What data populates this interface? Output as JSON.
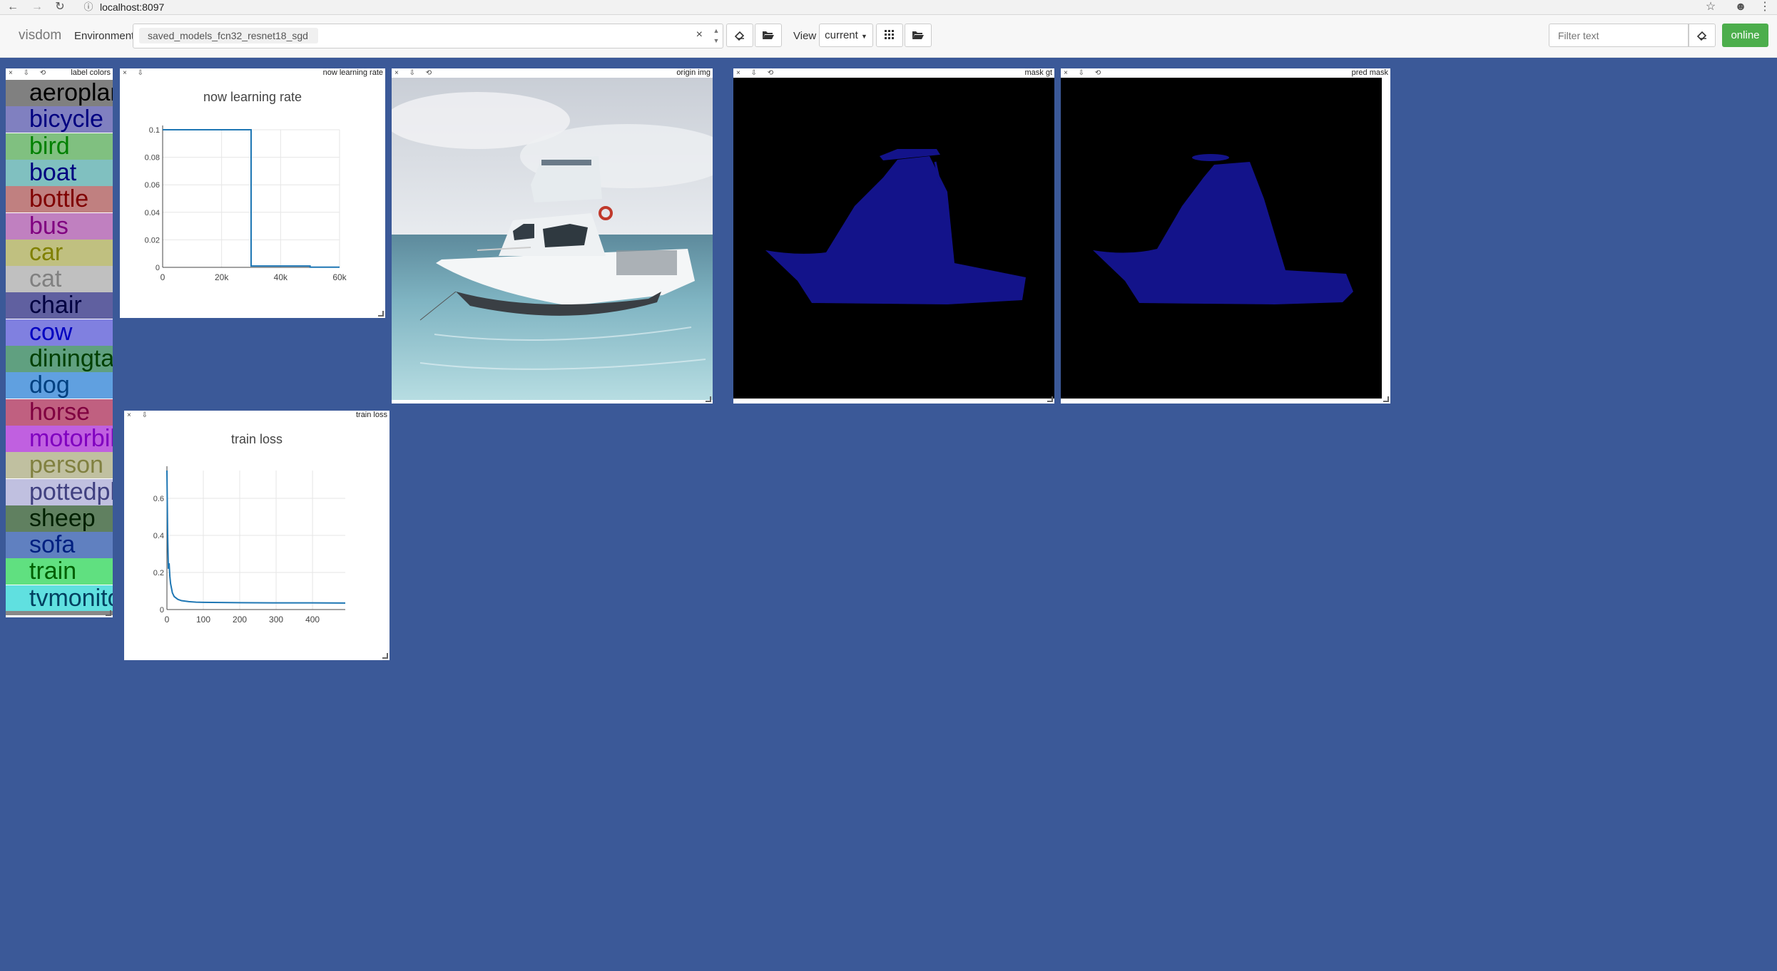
{
  "browser": {
    "url": "localhost:8097",
    "icons": [
      "back-arrow-icon",
      "forward-arrow-icon",
      "reload-icon",
      "info-icon",
      "star-icon",
      "account-icon",
      "menu-icon"
    ]
  },
  "toolbar": {
    "brand": "visdom",
    "environment_label": "Environment",
    "environment_value": "saved_models_fcn32_resnet18_sgd",
    "clear_symbol": "×",
    "view_label": "View",
    "view_value": "current",
    "filter_placeholder": "Filter text",
    "status": "online",
    "status_color": "#4cae4c"
  },
  "panes": {
    "labels": {
      "title": "label colors",
      "items": [
        {
          "label": "aeroplane",
          "color": "#808080",
          "text_color": "#000000"
        },
        {
          "label": "bicycle",
          "color": "#8080c0",
          "text_color": "#000080"
        },
        {
          "label": "bird",
          "color": "#80c080",
          "text_color": "#008000"
        },
        {
          "label": "boat",
          "color": "#80c0c0",
          "text_color": "#000080"
        },
        {
          "label": "bottle",
          "color": "#c08080",
          "text_color": "#800000"
        },
        {
          "label": "bus",
          "color": "#c080c0",
          "text_color": "#800080"
        },
        {
          "label": "car",
          "color": "#c0c080",
          "text_color": "#808000"
        },
        {
          "label": "cat",
          "color": "#c0c0c0",
          "text_color": "#808080"
        },
        {
          "label": "chair",
          "color": "#6060a0",
          "text_color": "#000040"
        },
        {
          "label": "cow",
          "color": "#8080e0",
          "text_color": "#0000c0"
        },
        {
          "label": "diningtable",
          "color": "#60a080",
          "text_color": "#004000"
        },
        {
          "label": "dog",
          "color": "#60a0e0",
          "text_color": "#004080"
        },
        {
          "label": "horse",
          "color": "#c06080",
          "text_color": "#800040"
        },
        {
          "label": "motorbike",
          "color": "#c060e0",
          "text_color": "#8000c0"
        },
        {
          "label": "person",
          "color": "#c0c0a0",
          "text_color": "#808040"
        },
        {
          "label": "pottedplant",
          "color": "#c0c0e0",
          "text_color": "#404080"
        },
        {
          "label": "sheep",
          "color": "#608060",
          "text_color": "#002000"
        },
        {
          "label": "sofa",
          "color": "#6080c0",
          "text_color": "#002080"
        },
        {
          "label": "train",
          "color": "#60e080",
          "text_color": "#006000"
        },
        {
          "label": "tvmonitor",
          "color": "#60e0e0",
          "text_color": "#004060"
        }
      ]
    },
    "lr": {
      "title": "now learning rate",
      "chart_title": "now learning rate"
    },
    "loss": {
      "title": "train loss",
      "chart_title": "train loss"
    },
    "origin": {
      "title": "origin img"
    },
    "mask_gt": {
      "title": "mask gt"
    },
    "pred_mask": {
      "title": "pred mask"
    }
  },
  "chart_data": [
    {
      "type": "line",
      "title": "now learning rate",
      "xlabel": "",
      "ylabel": "",
      "x": [
        0,
        1,
        30000,
        30001,
        50000,
        50001,
        60000
      ],
      "y": [
        0.1,
        0.1,
        0.1,
        0.001,
        0.001,
        0.0001,
        0.0001
      ],
      "xlim": [
        0,
        60000
      ],
      "ylim": [
        0,
        0.1
      ],
      "xticks": [
        "0",
        "20k",
        "40k",
        "60k"
      ],
      "yticks": [
        "0",
        "0.02",
        "0.04",
        "0.06",
        "0.08",
        "0.1"
      ],
      "grid": true,
      "color": "#1f77b4"
    },
    {
      "type": "line",
      "title": "train loss",
      "xlabel": "",
      "ylabel": "",
      "x": [
        0,
        2,
        4,
        6,
        8,
        10,
        15,
        20,
        30,
        40,
        60,
        80,
        100,
        150,
        200,
        300,
        400,
        490
      ],
      "y": [
        0.75,
        0.4,
        0.22,
        0.25,
        0.18,
        0.14,
        0.09,
        0.07,
        0.055,
        0.048,
        0.043,
        0.04,
        0.039,
        0.038,
        0.037,
        0.036,
        0.036,
        0.035
      ],
      "xlim": [
        0,
        490
      ],
      "ylim": [
        0,
        0.75
      ],
      "xticks": [
        "0",
        "100",
        "200",
        "300",
        "400"
      ],
      "yticks": [
        "0",
        "0.2",
        "0.4",
        "0.6"
      ],
      "grid": true,
      "color": "#1f77b4"
    }
  ]
}
